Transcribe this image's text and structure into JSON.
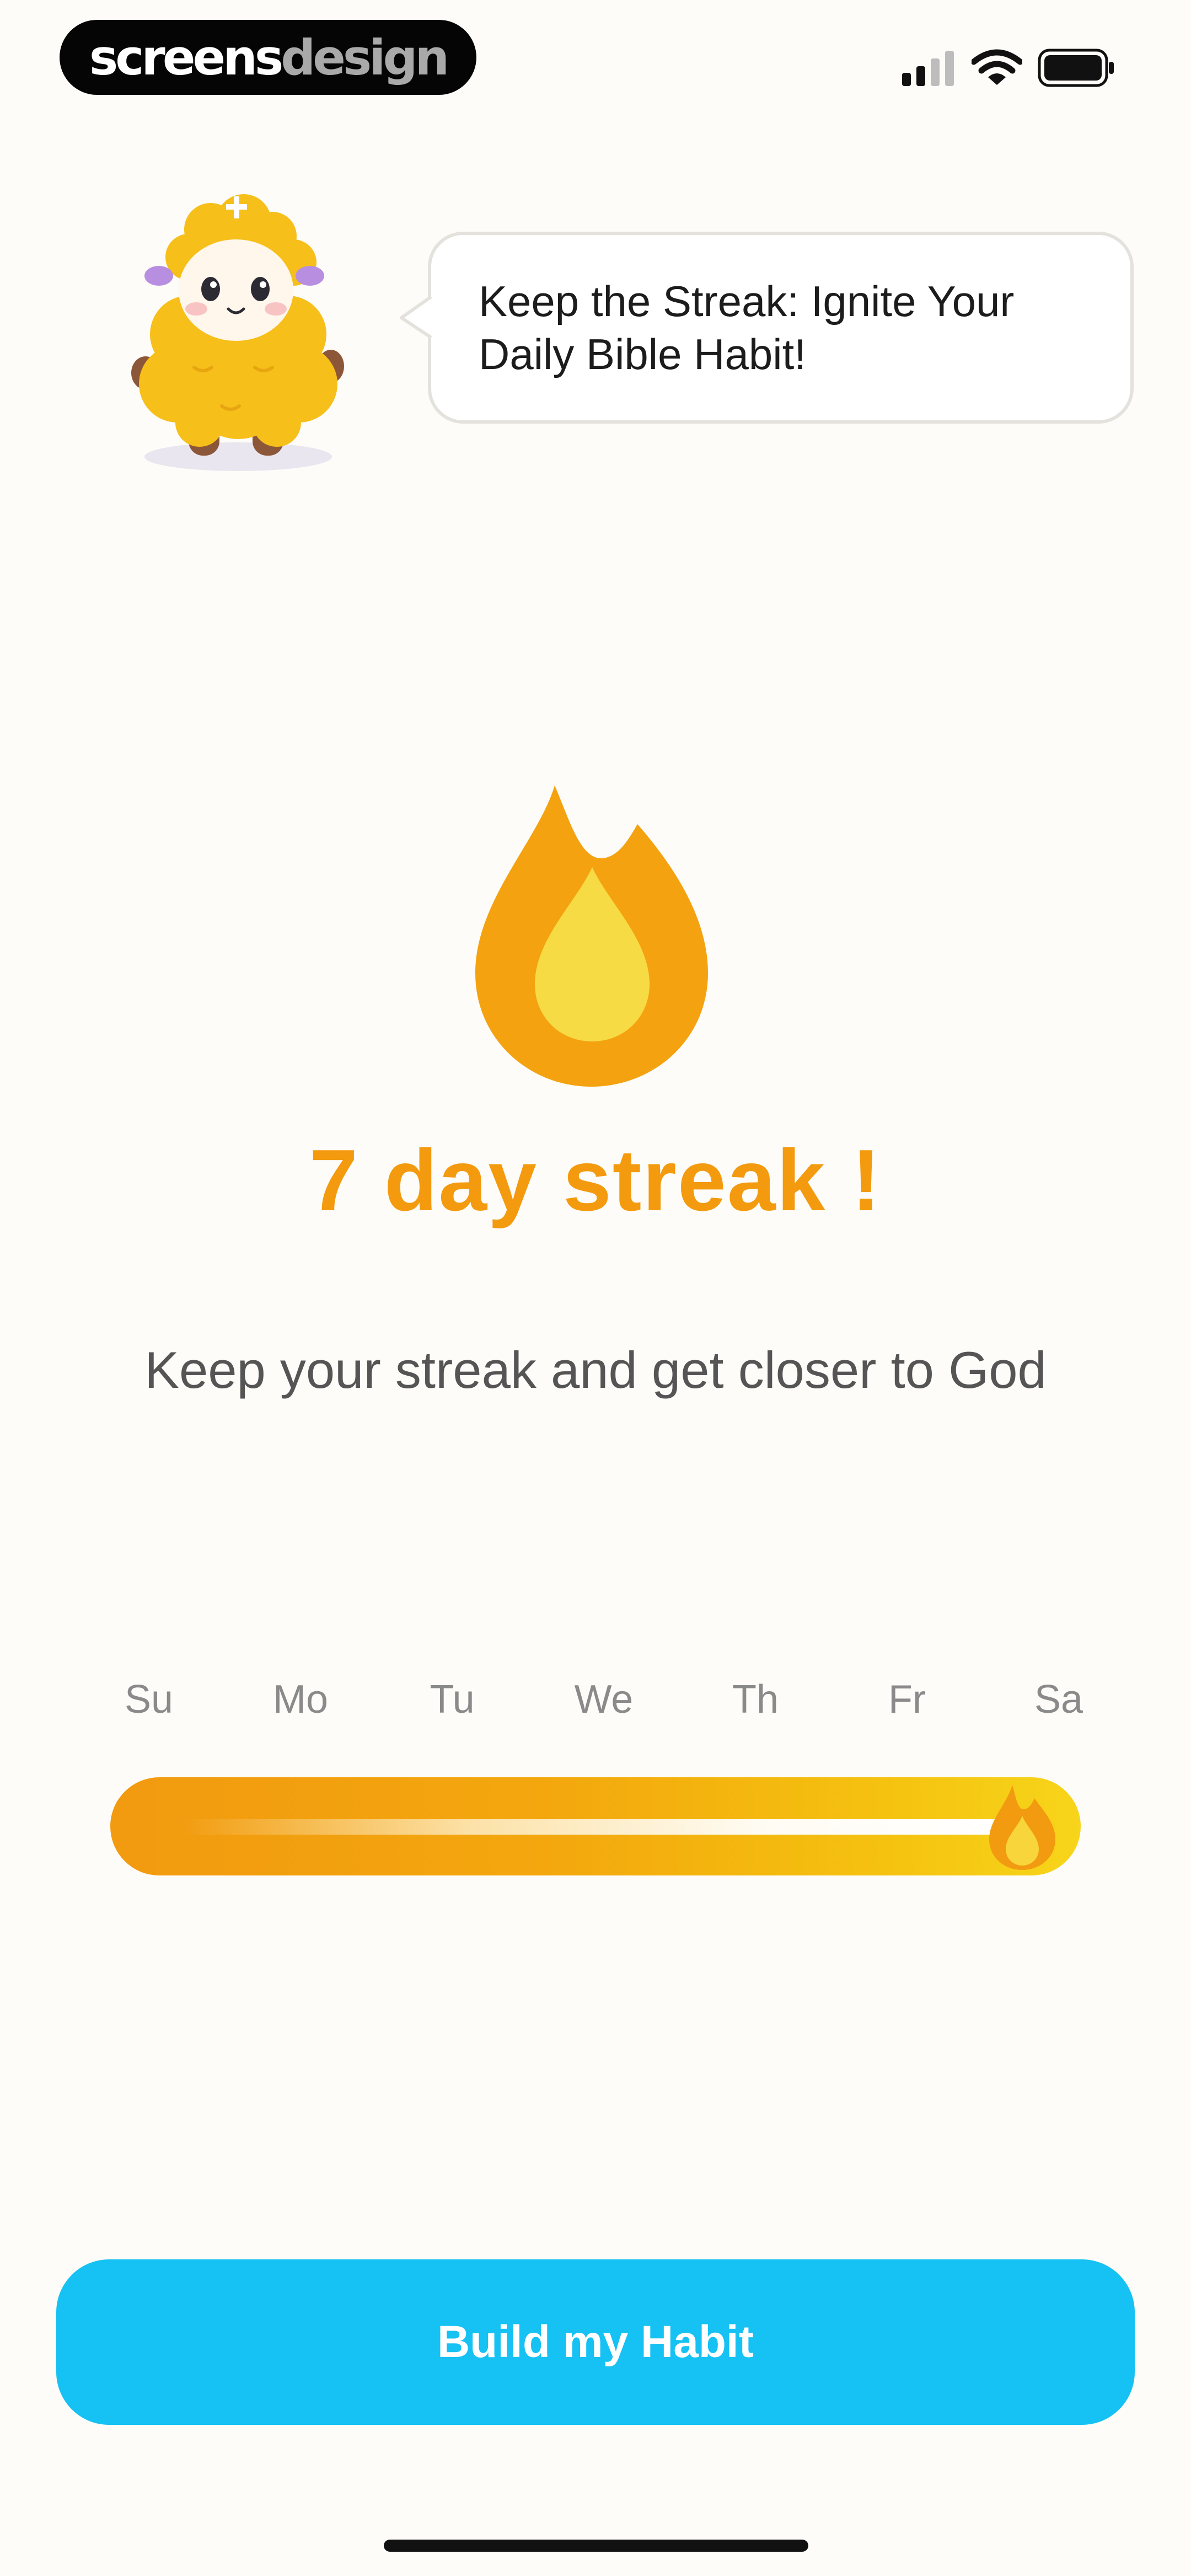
{
  "status_bar": {
    "brand_part1": "screens",
    "brand_part2": "design",
    "icons": [
      "cellular-signal-icon",
      "wifi-icon",
      "battery-icon"
    ]
  },
  "mascot": {
    "icon": "sheep-mascot-icon",
    "speech": "Keep the Streak: Ignite Your Daily Bible Habit!"
  },
  "streak": {
    "icon": "flame-icon",
    "title": "7 day streak !",
    "subtitle": "Keep your streak and get closer to God"
  },
  "week": {
    "days": [
      "Su",
      "Mo",
      "Tu",
      "We",
      "Th",
      "Fr",
      "Sa"
    ],
    "progress": 1.0,
    "end_icon": "flame-icon"
  },
  "cta": {
    "label": "Build my Habit"
  },
  "colors": {
    "background": "#fdfcf8",
    "accent_orange": "#f39a0e",
    "flame_yellow": "#f7db45",
    "button_blue": "#16c1f3"
  }
}
